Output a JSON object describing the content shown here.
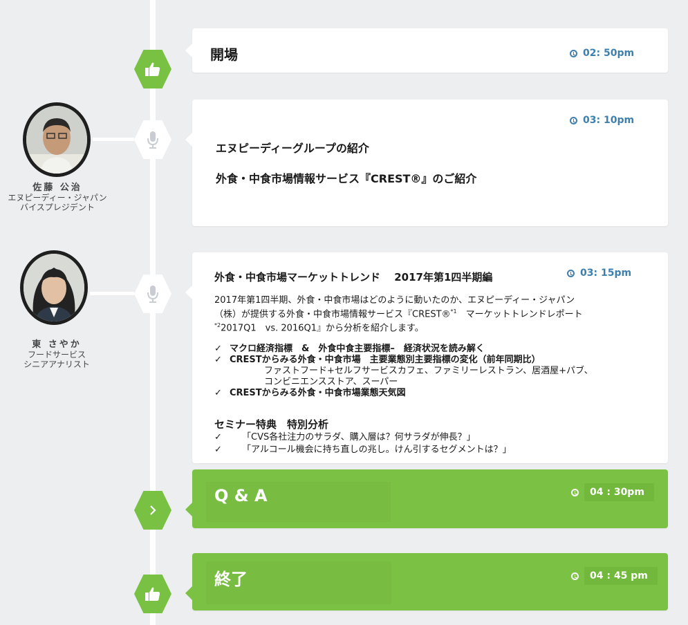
{
  "colors": {
    "accent_green": "#7bc143",
    "time_blue": "#3d7fae",
    "background": "#eceef0"
  },
  "events": {
    "opening": {
      "title": "開場",
      "time": "02: 50pm",
      "icon": "thumbs-up-icon"
    },
    "intro": {
      "time": "03: 10pm",
      "line1": "エヌピーディーグループの紹介",
      "line2": "外食・中食市場情報サービス『CREST®』のご紹介",
      "icon": "microphone-icon"
    },
    "trend": {
      "title": "外食・中食市場マーケットトレンド　 2017年第1四半期編",
      "time": "03: 15pm",
      "desc_line1": "2017年第1四半期、外食・中食市場はどのように動いたのか、エヌピーディー・ジャパン",
      "desc_line2": "（株）が提供する外食・中食市場情報サービス『CREST®",
      "desc_sup1": "*1",
      "desc_line2b": "　マーケットトレンドレポート",
      "desc_sup2": "*2",
      "desc_line3": "2017Q1　vs. 2016Q1』から分析を紹介します。",
      "points": [
        "マクロ経済指標　&　外食中食主要指標–　経済状況を読み解く",
        "CRESTからみる外食・中食市場　主要業態別主要指標の変化（前年同期比）"
      ],
      "sub_line1": "ファストフード+セルフサービスカフェ、ファミリーレストラン、居酒屋+パブ、",
      "sub_line2": "コンビニエンスストア、スーパー",
      "point3": "CRESTからみる外食・中食市場業態天気図",
      "bonus_title": "セミナー特典　特別分析",
      "bonus_items": [
        "「CVS各社注力のサラダ、購入層は？何サラダが伸長？」",
        "「アルコール機会に持ち直しの兆し。けん引するセグメントは？」"
      ],
      "check_mark": "✓",
      "icon": "microphone-icon"
    },
    "qa": {
      "title": "Q & A",
      "time": "04 : 30pm",
      "icon": "chevron-right-icon"
    },
    "end": {
      "title": "終了",
      "time": "04 : 45 pm",
      "icon": "thumbs-up-icon"
    }
  },
  "speakers": [
    {
      "name": "佐藤 公治",
      "org": "エヌピーディー・ジャパン",
      "role": "バイスプレジデント"
    },
    {
      "name": "東 さやか",
      "org": "フードサービス",
      "role": "シニアアナリスト"
    }
  ]
}
